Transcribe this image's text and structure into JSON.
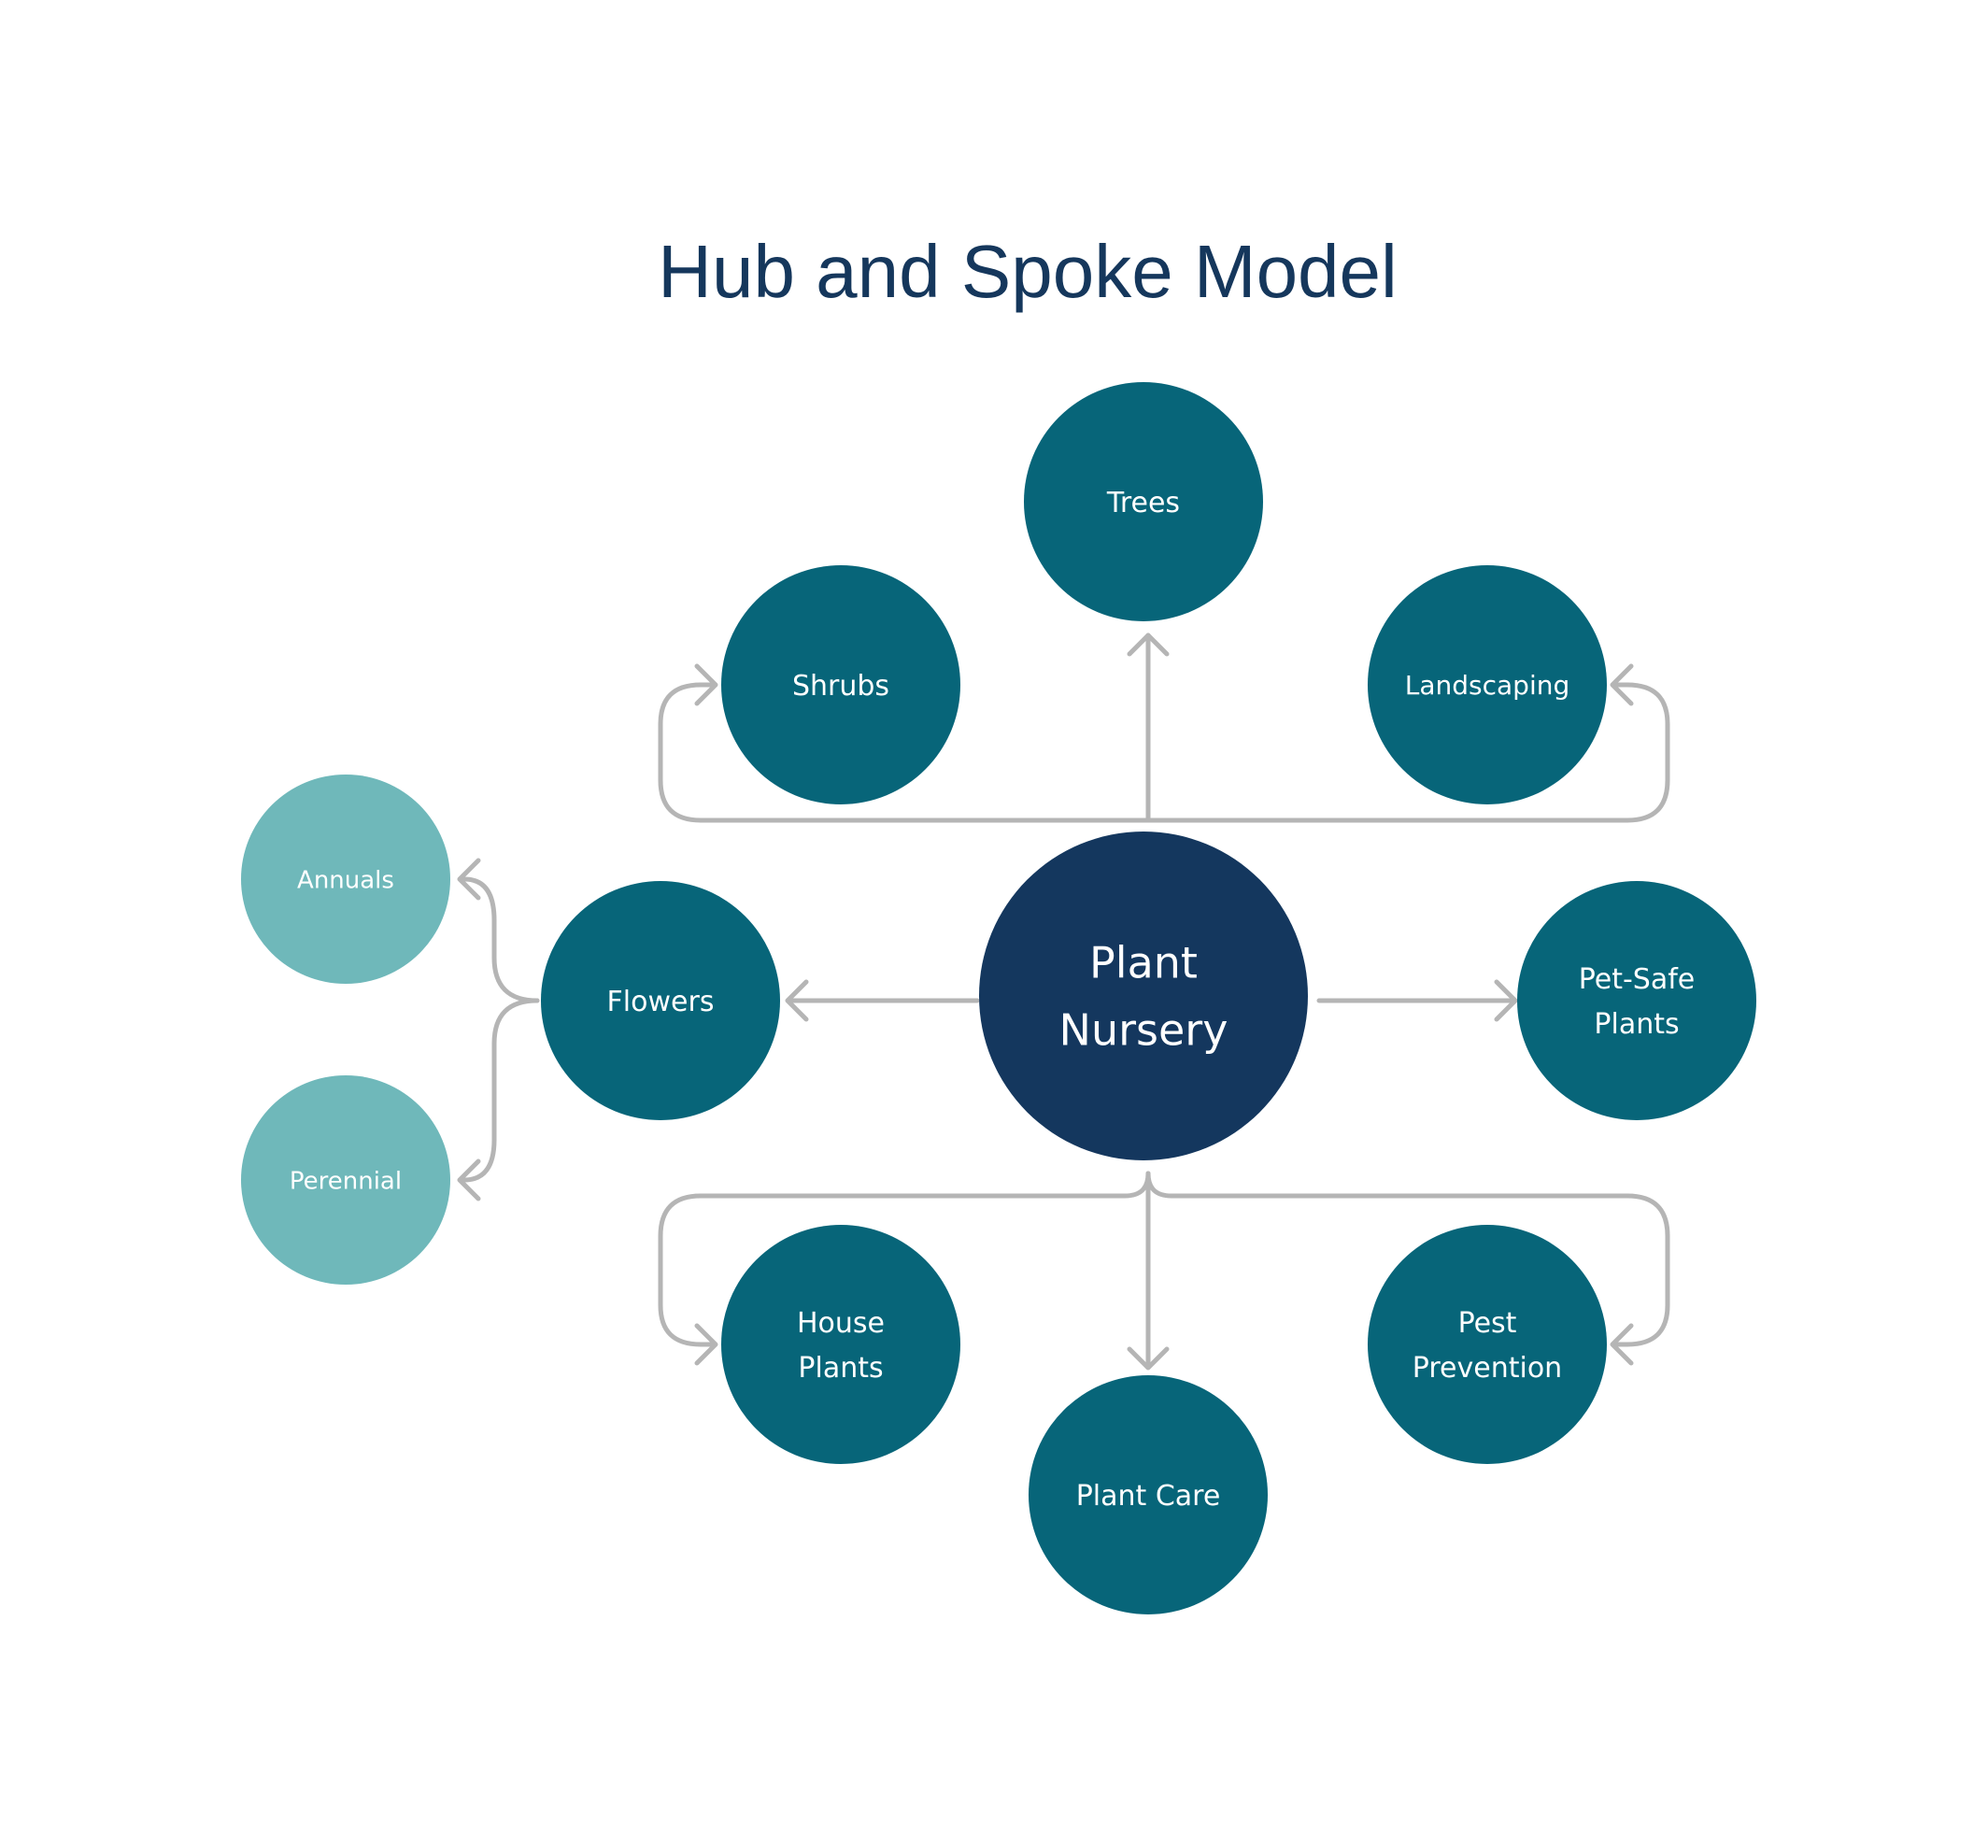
{
  "title": "Hub and Spoke Model",
  "colors": {
    "title": "#15375c",
    "hub": "#14375e",
    "spoke": "#076579",
    "subspoke": "#6fb8ba",
    "connector": "#b5b5b5",
    "text_light": "#ffffff",
    "text_dark": "#1c2a2c"
  },
  "hub": {
    "id": "plant-nursery",
    "lines": [
      "Plant",
      "Nursery"
    ]
  },
  "spokes": [
    {
      "id": "trees",
      "lines": [
        "Trees"
      ]
    },
    {
      "id": "shrubs",
      "lines": [
        "Shrubs"
      ]
    },
    {
      "id": "landscaping",
      "lines": [
        "Landscaping"
      ]
    },
    {
      "id": "flowers",
      "lines": [
        "Flowers"
      ]
    },
    {
      "id": "pet-safe-plants",
      "lines": [
        "Pet-Safe",
        "Plants"
      ]
    },
    {
      "id": "house-plants",
      "lines": [
        "House",
        "Plants"
      ]
    },
    {
      "id": "plant-care",
      "lines": [
        "Plant Care"
      ]
    },
    {
      "id": "pest-prevention",
      "lines": [
        "Pest",
        "Prevention"
      ]
    }
  ],
  "subspokes": [
    {
      "id": "annuals",
      "parent": "flowers",
      "lines": [
        "Annuals"
      ]
    },
    {
      "id": "perennial",
      "parent": "flowers",
      "lines": [
        "Perennial"
      ]
    }
  ],
  "edges": [
    {
      "from": "plant-nursery",
      "to": "trees"
    },
    {
      "from": "plant-nursery",
      "to": "shrubs"
    },
    {
      "from": "plant-nursery",
      "to": "landscaping"
    },
    {
      "from": "plant-nursery",
      "to": "flowers"
    },
    {
      "from": "plant-nursery",
      "to": "pet-safe-plants"
    },
    {
      "from": "plant-nursery",
      "to": "house-plants"
    },
    {
      "from": "plant-nursery",
      "to": "plant-care"
    },
    {
      "from": "plant-nursery",
      "to": "pest-prevention"
    },
    {
      "from": "flowers",
      "to": "annuals"
    },
    {
      "from": "flowers",
      "to": "perennial"
    }
  ]
}
